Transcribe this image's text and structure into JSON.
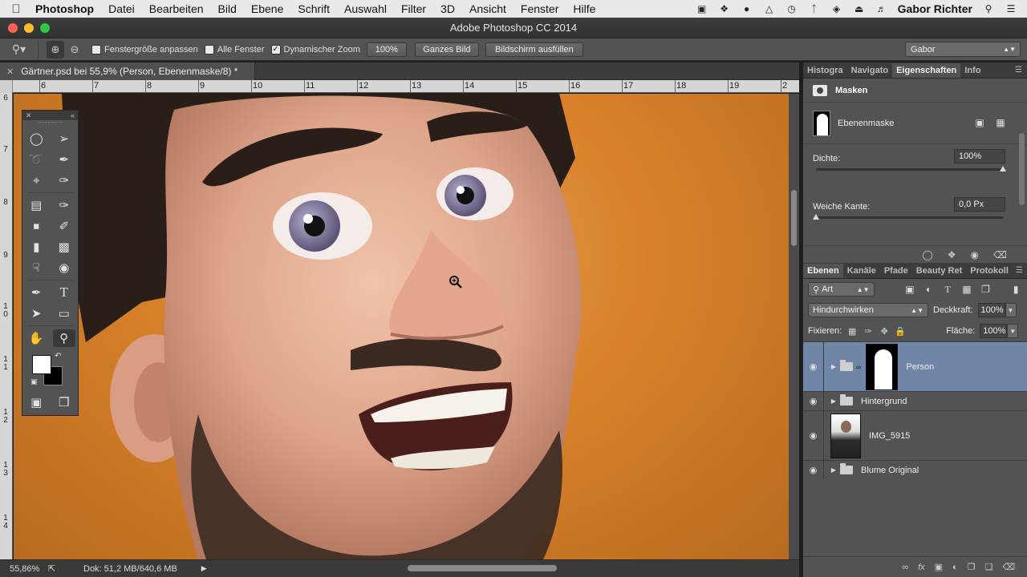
{
  "menubar": {
    "app": "Photoshop",
    "items": [
      "Datei",
      "Bearbeiten",
      "Bild",
      "Ebene",
      "Schrift",
      "Auswahl",
      "Filter",
      "3D",
      "Ansicht",
      "Fenster",
      "Hilfe"
    ],
    "user": "Gabor Richter",
    "tray_icons": [
      "display-icon",
      "dropbox-icon",
      "leaf-icon",
      "airplay-icon",
      "time-machine-icon",
      "bluetooth-icon",
      "wifi-icon",
      "eject-icon",
      "volume-icon"
    ]
  },
  "window": {
    "title": "Adobe Photoshop CC 2014"
  },
  "options": {
    "fit_window": "Fenstergröße anpassen",
    "all_windows": "Alle Fenster",
    "scrubby_zoom": "Dynamischer Zoom",
    "scrubby_zoom_checked": true,
    "btn_100": "100%",
    "btn_fit": "Ganzes Bild",
    "btn_fill": "Bildschirm ausfüllen",
    "workspace": "Gabor"
  },
  "document": {
    "tab_title": "Gärtner.psd bei 55,9% (Person, Ebenenmaske/8) *",
    "ruler_top": [
      "6",
      "7",
      "8",
      "9",
      "10",
      "11",
      "12",
      "13",
      "14",
      "15",
      "16",
      "17",
      "18",
      "19",
      "2"
    ],
    "ruler_left": [
      "6",
      "7",
      "8",
      "9",
      "1\n0",
      "1\n1",
      "1\n2",
      "1\n3",
      "1\n4"
    ]
  },
  "status": {
    "zoom": "55,86%",
    "doc": "Dok: 51,2 MB/640,6 MB"
  },
  "props_panel": {
    "tabs": [
      "Histogra",
      "Navigato",
      "Eigenschaften",
      "Info"
    ],
    "active_tab": "Eigenschaften",
    "section": "Masken",
    "mask_label": "Ebenenmaske",
    "density_label": "Dichte:",
    "density_value": "100%",
    "feather_label": "Weiche Kante:",
    "feather_value": "0,0 Px"
  },
  "layers_panel": {
    "tabs": [
      "Ebenen",
      "Kanäle",
      "Pfade",
      "Beauty Ret",
      "Protokoll"
    ],
    "active_tab": "Ebenen",
    "filter_kind": "Art",
    "blend_mode": "Hindurchwirken",
    "opacity_label": "Deckkraft:",
    "opacity_value": "100%",
    "lock_label": "Fixieren:",
    "fill_label": "Fläche:",
    "fill_value": "100%",
    "layers": [
      {
        "name": "Person",
        "type": "group-mask",
        "selected": true
      },
      {
        "name": "Hintergrund",
        "type": "group",
        "selected": false
      },
      {
        "name": "IMG_5915",
        "type": "smart-object",
        "selected": false
      },
      {
        "name": "Blume Original",
        "type": "group",
        "selected": false
      }
    ]
  }
}
